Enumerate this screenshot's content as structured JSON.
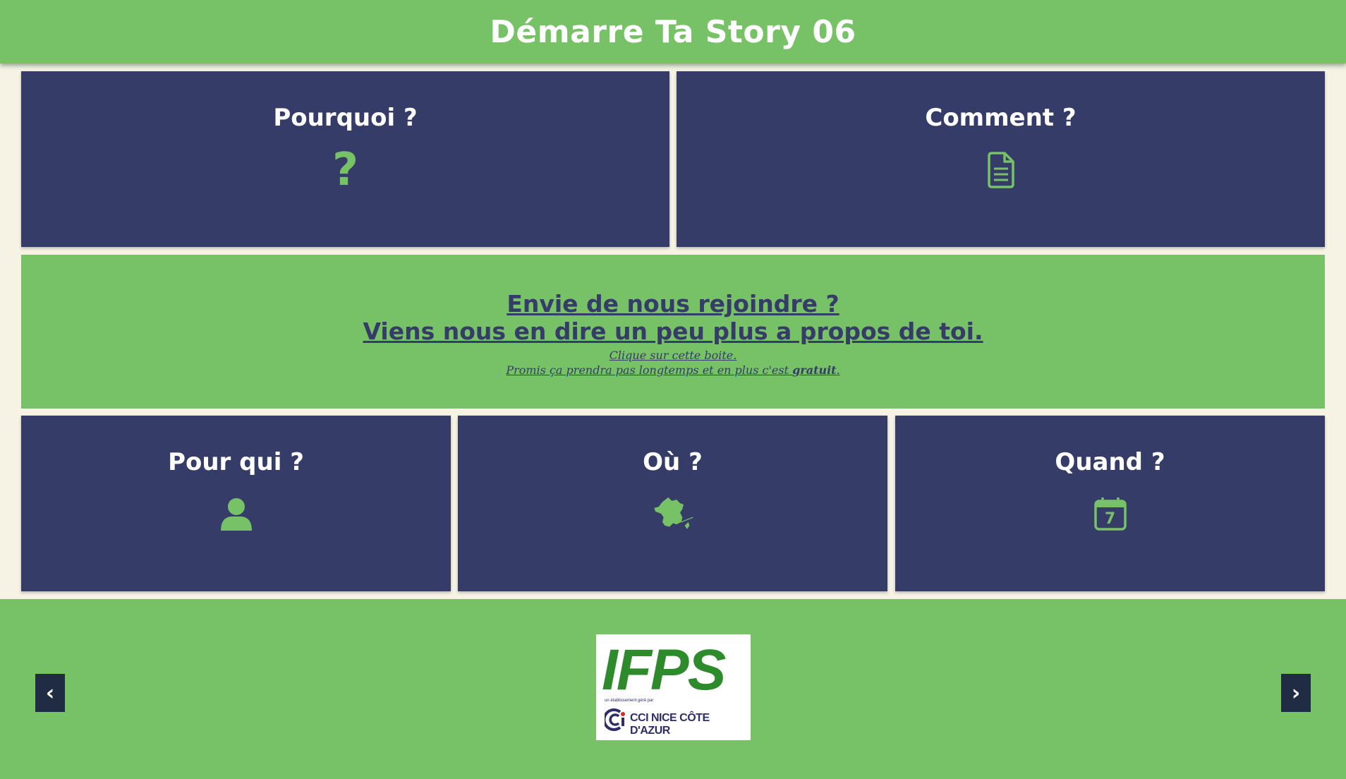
{
  "header": {
    "title": "Démarre Ta Story 06"
  },
  "cards_top": [
    {
      "title": "Pourquoi ?",
      "icon": "question-mark-icon"
    },
    {
      "title": "Comment ?",
      "icon": "document-icon"
    }
  ],
  "cta": {
    "line1": "Envie de nous rejoindre ?",
    "line2": "Viens nous en dire un peu plus a propos de toi.",
    "sub1": "Clique sur cette boite.",
    "sub2_prefix": "Promis ça prendra pas longtemps et en plus c'est ",
    "sub2_bold": "gratuit",
    "sub2_suffix": "."
  },
  "cards_bottom": [
    {
      "title": "Pour qui ?",
      "icon": "user-icon"
    },
    {
      "title": "Où ?",
      "icon": "france-map-icon"
    },
    {
      "title": "Quand ?",
      "icon": "calendar-icon",
      "calendar_day": "7"
    }
  ],
  "carousel": {
    "prev_label": "‹",
    "next_label": "›",
    "logo": {
      "main_text": "IFPS",
      "small_text": "un établissement géré par",
      "cci_text": "CCI NICE CÔTE D'AZUR"
    }
  },
  "colors": {
    "accent_green": "#77c267",
    "card_navy": "#353c68",
    "background": "#f6f3e4",
    "arrow_bg": "#1f2c44"
  }
}
